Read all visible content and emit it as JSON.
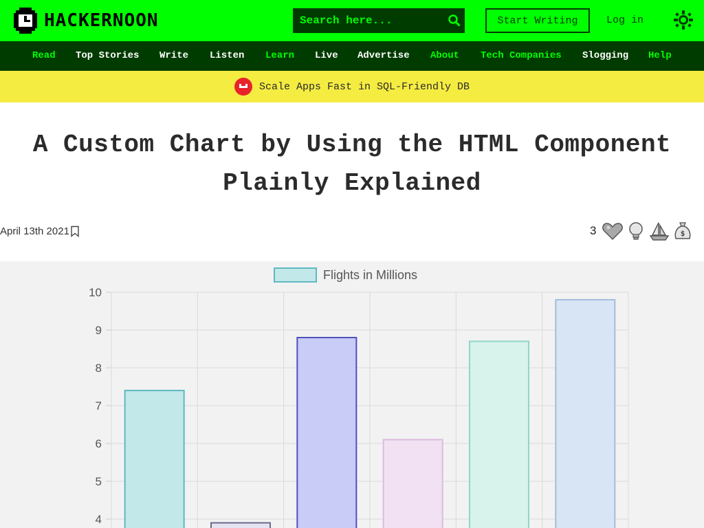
{
  "header": {
    "logo_text": "HACKERNOON",
    "search_placeholder": "Search here...",
    "start_writing_label": "Start Writing",
    "login_label": "Log in"
  },
  "nav": {
    "items": [
      {
        "label": "Read",
        "color": "#00ff00"
      },
      {
        "label": "Top Stories",
        "color": "#ffffff"
      },
      {
        "label": "Write",
        "color": "#ffffff"
      },
      {
        "label": "Listen",
        "color": "#ffffff"
      },
      {
        "label": "Learn",
        "color": "#00ff00"
      },
      {
        "label": "Live",
        "color": "#ffffff"
      },
      {
        "label": "Advertise",
        "color": "#ffffff"
      },
      {
        "label": "About",
        "color": "#00ff00"
      },
      {
        "label": "Tech Companies",
        "color": "#00ff00"
      },
      {
        "label": "Slogging",
        "color": "#ffffff"
      },
      {
        "label": "Help",
        "color": "#00ff00"
      }
    ]
  },
  "banner": {
    "text": "Scale Apps Fast in SQL-Friendly DB"
  },
  "article": {
    "title_line1": "A Custom Chart by Using the HTML Component",
    "title_line2": "Plainly Explained",
    "date": "April 13th 2021",
    "reaction_count": "3"
  },
  "icons": {
    "search": "search-icon",
    "theme": "sun-icon",
    "bookmark": "bookmark-icon",
    "reactions": [
      "heart-icon",
      "lightbulb-icon",
      "boat-icon",
      "money-bag-icon"
    ]
  },
  "colors": {
    "brand_green": "#00ff00",
    "dark_green": "#003b00",
    "banner_yellow": "#f5ec42"
  },
  "chart_data": {
    "type": "bar",
    "legend": "Flights in Millions",
    "legend_position": "top",
    "grid": true,
    "yticks": [
      10,
      9,
      8,
      7,
      6,
      5,
      4
    ],
    "ylim": [
      4,
      10
    ],
    "values": [
      7.4,
      3.9,
      8.8,
      6.1,
      8.7,
      9.8
    ],
    "bar_fills": [
      "#c3e8ea",
      "#e4e3f2",
      "#c8ccf7",
      "#f1e1f3",
      "#d7f3ec",
      "#d8e5f5"
    ],
    "bar_strokes": [
      "#5fb9c1",
      "#6b6a8c",
      "#4f52b8",
      "#dcbbe0",
      "#8fd6c8",
      "#a2bddc"
    ]
  }
}
